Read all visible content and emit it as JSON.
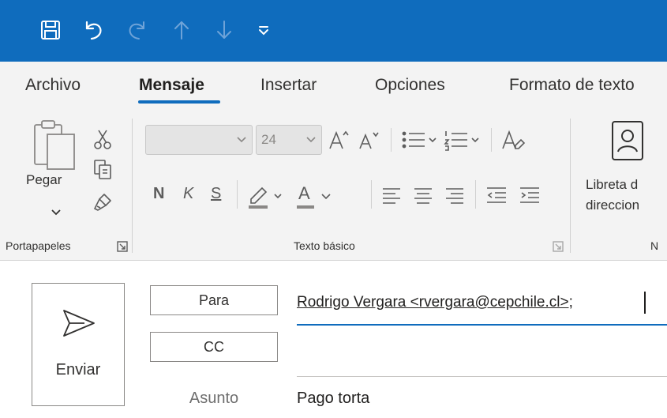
{
  "quick_access": {
    "icons": [
      "save-icon",
      "undo-icon",
      "redo-icon",
      "up-arrow-icon",
      "down-arrow-icon",
      "customize-icon"
    ]
  },
  "tabs": [
    "Archivo",
    "Mensaje",
    "Insertar",
    "Opciones",
    "Formato de texto"
  ],
  "active_tab": "Mensaje",
  "ribbon": {
    "clipboard": {
      "paste_label": "Pegar",
      "group_label": "Portapapeles"
    },
    "basic_text": {
      "font_size": "24",
      "bold": "N",
      "italic": "K",
      "underline": "S",
      "font_color_letter": "A",
      "group_label": "Texto básico"
    },
    "names": {
      "address_book_label_1": "Libreta d",
      "address_book_label_2": "direccion",
      "group_label": "N"
    }
  },
  "compose": {
    "send_label": "Enviar",
    "to_label": "Para",
    "cc_label": "CC",
    "subject_label": "Asunto",
    "to_value": "Rodrigo Vergara <rvergara@cepchile.cl>;",
    "cc_value": "",
    "subject_value": "Pago torta"
  },
  "colors": {
    "title_bar": "#0f6cbd",
    "accent": "#0f6cbd",
    "ribbon_bg": "#f3f3f3"
  }
}
